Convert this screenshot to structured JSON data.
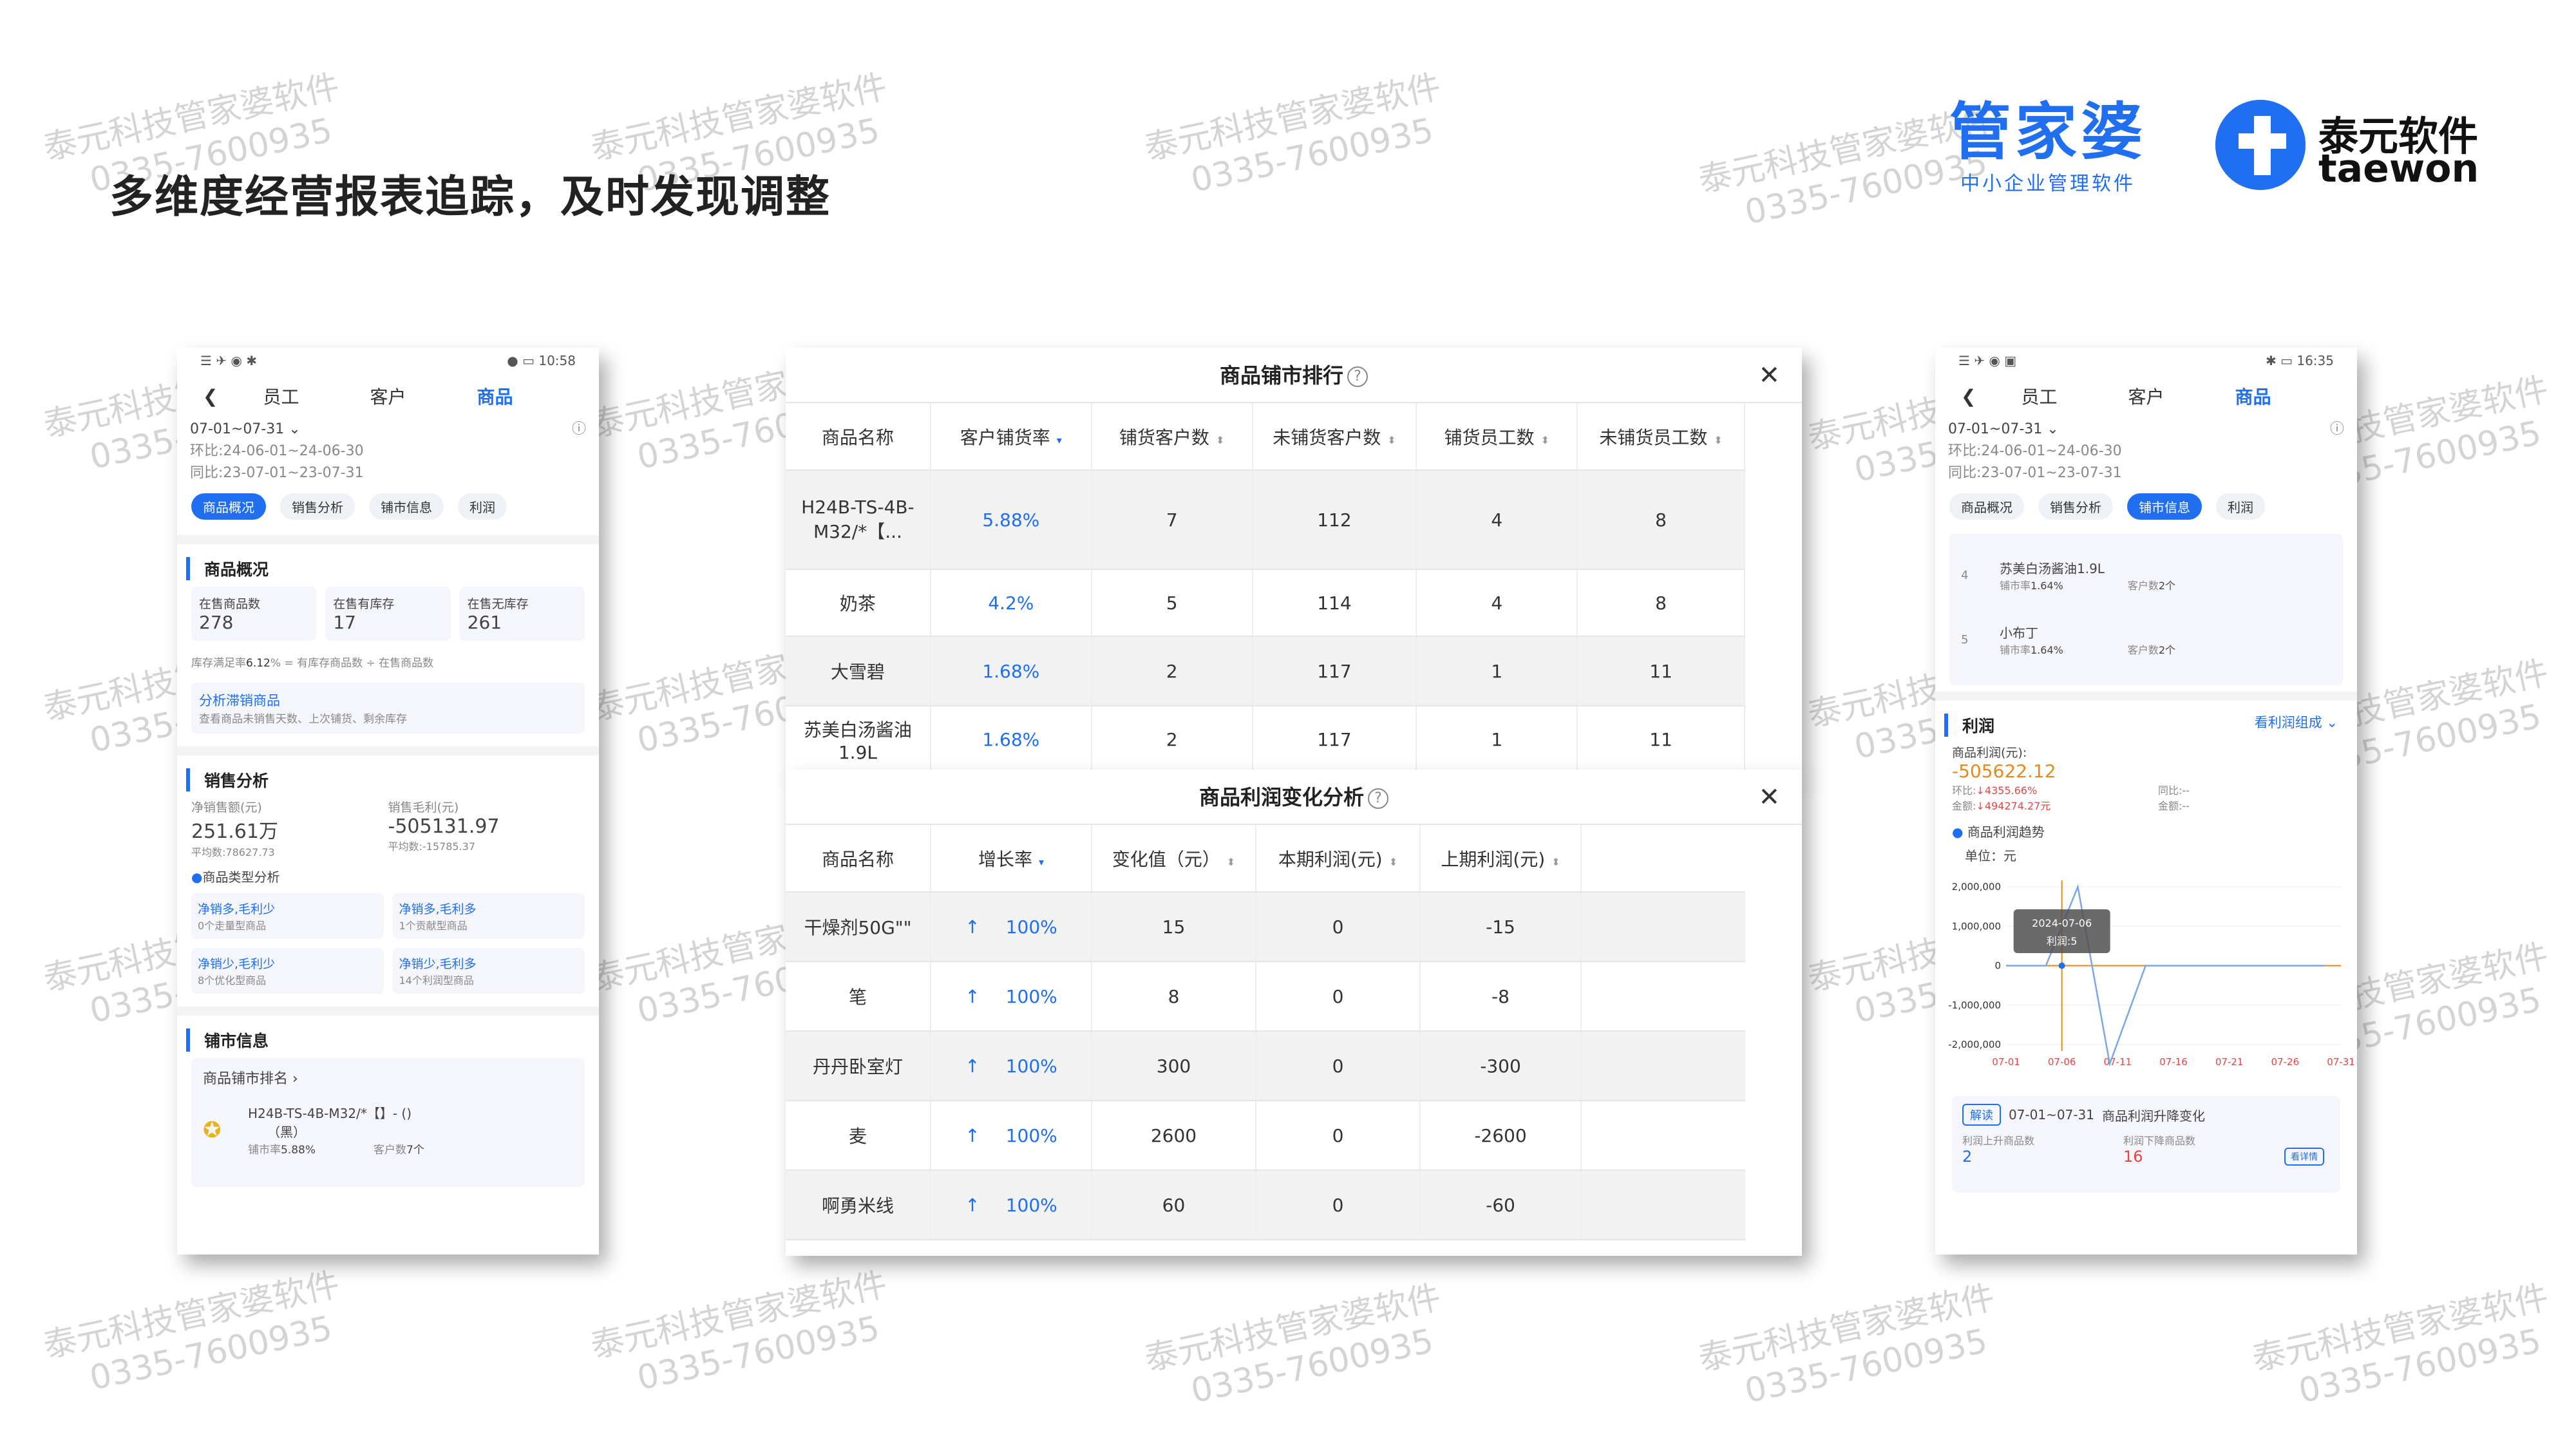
{
  "watermark": {
    "line1": "泰元科技管家婆软件",
    "line2": "0335-7600935"
  },
  "headline": "多维度经营报表追踪，及时发现调整",
  "brand_gjp": {
    "name": "管家婆",
    "tagline": "中小企业管理软件"
  },
  "brand_taiyuan": {
    "name_cn": "泰元软件",
    "name_en": "taewon"
  },
  "phone_left": {
    "status_time": "10:58",
    "tabs": [
      "员工",
      "客户",
      "商品"
    ],
    "date_range": "07-01~07-31",
    "huanbi": "环比:24-06-01~24-06-30",
    "tongbi": "同比:23-07-01~23-07-31",
    "pills": [
      "商品概况",
      "销售分析",
      "铺市信息",
      "利润"
    ],
    "overview_title": "商品概况",
    "stats": [
      {
        "label": "在售商品数",
        "value": "278"
      },
      {
        "label": "在售有库存",
        "value": "17"
      },
      {
        "label": "在售无库存",
        "value": "261"
      }
    ],
    "stock_note_prefix": "库存满足率",
    "stock_note_value": "6.12",
    "stock_note_suffix": "% = 有库存商品数 ÷ 在售商品数",
    "slow_title": "分析滞销商品",
    "slow_desc": "查看商品未销售天数、上次铺货、剩余库存",
    "sales_title": "销售分析",
    "net_sales_label": "净销售额(元)",
    "net_sales_value": "251.61万",
    "net_sales_avg": "平均数:78627.73",
    "gross_label": "销售毛利(元)",
    "gross_value": "-505131.97",
    "gross_avg": "平均数:-15785.37",
    "type_title": "商品类型分析",
    "types": [
      {
        "title": "净销多,毛利少",
        "desc": "0个走量型商品"
      },
      {
        "title": "净销多,毛利多",
        "desc": "1个贡献型商品"
      },
      {
        "title": "净销少,毛利少",
        "desc": "8个优化型商品"
      },
      {
        "title": "净销少,毛利多",
        "desc": "14个利润型商品"
      }
    ],
    "shop_title": "铺市信息",
    "rank_title": "商品铺市排名",
    "rank_item": {
      "name": "H24B-TS-4B-M32/*【】- ()",
      "sub": "（黑）",
      "rate_label": "铺市率",
      "rate": "5.88%",
      "cust_label": "客户数",
      "cust": "7个"
    }
  },
  "table1": {
    "title": "商品铺市排行",
    "headers": [
      "商品名称",
      "客户铺货率",
      "铺货客户数",
      "未铺货客户数",
      "铺货员工数",
      "未铺货员工数"
    ],
    "rows": [
      [
        "H24B-TS-4B-M32/*【...",
        "5.88%",
        "7",
        "112",
        "4",
        "8"
      ],
      [
        "奶茶",
        "4.2%",
        "5",
        "114",
        "4",
        "8"
      ],
      [
        "大雪碧",
        "1.68%",
        "2",
        "117",
        "1",
        "11"
      ],
      [
        "苏美白汤酱油1.9L",
        "1.68%",
        "2",
        "117",
        "1",
        "11"
      ]
    ]
  },
  "table2": {
    "title": "商品利润变化分析",
    "headers": [
      "商品名称",
      "增长率",
      "变化值（元）",
      "本期利润(元)",
      "上期利润(元)"
    ],
    "rows": [
      [
        "干燥剂50G\"\"",
        "100%",
        "15",
        "0",
        "-15"
      ],
      [
        "笔",
        "100%",
        "8",
        "0",
        "-8"
      ],
      [
        "丹丹卧室灯",
        "100%",
        "300",
        "0",
        "-300"
      ],
      [
        "麦",
        "100%",
        "2600",
        "0",
        "-2600"
      ],
      [
        "啊勇米线",
        "100%",
        "60",
        "0",
        "-60"
      ]
    ]
  },
  "phone_right": {
    "status_time": "16:35",
    "tabs": [
      "员工",
      "客户",
      "商品"
    ],
    "date_range": "07-01~07-31",
    "huanbi": "环比:24-06-01~24-06-30",
    "tongbi": "同比:23-07-01~23-07-31",
    "pills": [
      "商品概况",
      "销售分析",
      "铺市信息",
      "利润"
    ],
    "rank_items": [
      {
        "no": "4",
        "name": "苏美白汤酱油1.9L",
        "rate_label": "铺市率",
        "rate": "1.64%",
        "cust_label": "客户数",
        "cust": "2个"
      },
      {
        "no": "5",
        "name": "小布丁",
        "rate_label": "铺市率",
        "rate": "1.64%",
        "cust_label": "客户数",
        "cust": "2个"
      }
    ],
    "profit_title": "利润",
    "profit_link": "看利润组成",
    "profit_label": "商品利润(元):",
    "profit_value": "-505622.12",
    "hb_label": "环比:",
    "hb_value": "4355.66%",
    "tb_label": "同比:",
    "tb_value": "--",
    "amt_label": "金额:",
    "amt_value": "494274.27元",
    "amt2_label": "金额:",
    "amt2_value": "--",
    "trend_title": "商品利润趋势",
    "unit": "单位：元",
    "tooltip_date": "2024-07-06",
    "tooltip_value": "利润:5",
    "read_tag": "解读",
    "read_range": "07-01~07-31",
    "read_title": "商品利润升降变化",
    "up_label": "利润上升商品数",
    "up_value": "2",
    "down_label": "利润下降商品数",
    "down_value": "16",
    "detail_btn": "看详情"
  },
  "chart_data": {
    "type": "line",
    "title": "商品利润趋势",
    "ylabel": "单位：元",
    "x": [
      "07-01",
      "07-06",
      "07-11",
      "07-16",
      "07-21",
      "07-26",
      "07-31"
    ],
    "ylim": [
      -2000000,
      2000000
    ],
    "yticks": [
      "2,000,000",
      "1,000,000",
      "0",
      "-1,000,000",
      "-2,000,000"
    ],
    "series": [
      {
        "values": [
          0,
          5,
          2000000,
          -2500000,
          0,
          0,
          0,
          0,
          0,
          0
        ]
      }
    ],
    "series_x": [
      0,
      1,
      1.8,
      2.6,
      3.5,
      4,
      5,
      6,
      7,
      8
    ]
  }
}
